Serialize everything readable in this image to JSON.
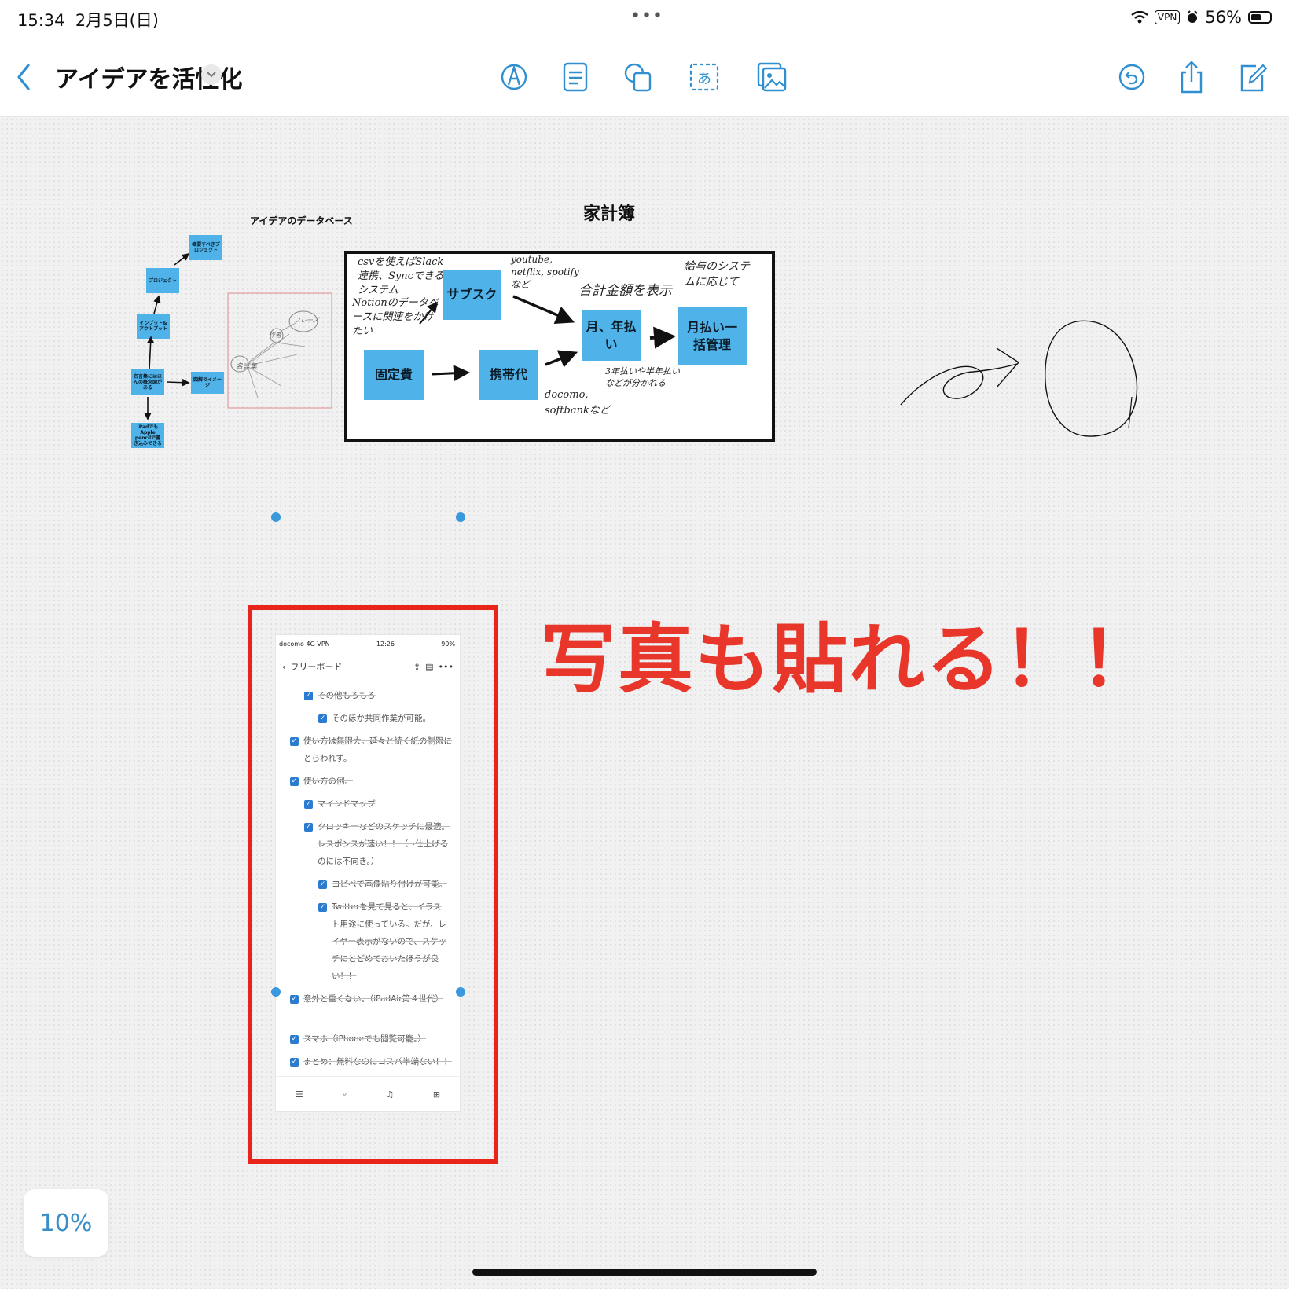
{
  "status_bar": {
    "time": "15:34",
    "date": "2月5日(日)",
    "vpn": "VPN",
    "battery_text": "56%",
    "battery_level": 0.56,
    "dots": "•••"
  },
  "toolbar": {
    "title": "アイデアを活性化"
  },
  "canvas": {
    "mindmap": {
      "title": "アイデアのデータベース",
      "nodes": [
        "概要すべきプロジェクト",
        "プロジェクト",
        "インプット&アウトプット",
        "名言集にはほんの概念図がある",
        "図解でイメージ",
        "iPadでもApple pencilで書き込みできる"
      ],
      "sketch_labels": [
        "名言集",
        "フレーズ",
        "作者"
      ]
    },
    "flow": {
      "title": "家計簿",
      "boxes": [
        "サブスク",
        "固定費",
        "携帯代",
        "月、年払い",
        "月払い一括管理"
      ],
      "notes": [
        "csvを使えばSlack連携、Syncできるシステム",
        "Notionのデータベースに関連をかけたい",
        "youtube, netflix, spotifyなど",
        "合計金額を表示",
        "給与のシステムに応じて",
        "docomo, softbankなど",
        "3年払いや半年払いなどが分かれる"
      ]
    },
    "pasted_screenshot": {
      "status": {
        "carrier": "docomo",
        "network": "4G",
        "vpn": "VPN",
        "time": "12:26",
        "battery": "90%"
      },
      "header_title": "フリーボード",
      "items": [
        {
          "text": "その他もろもろ",
          "level": 1
        },
        {
          "text": "そのほか共同作業が可能。",
          "level": 2
        },
        {
          "text": "使い方は無限大。延々と続く紙の制限にとらわれず。",
          "level": 0
        },
        {
          "text": "使い方の例。",
          "level": 0
        },
        {
          "text": "マインドマップ",
          "level": 1
        },
        {
          "text": "クロッキーなどのスケッチに最適。レスポンスが速い！！（→仕上げるのには不向き。）",
          "level": 1
        },
        {
          "text": "コピペで画像貼り付けが可能。",
          "level": 2
        },
        {
          "text": "Twitterを見て見ると、イラスト用途に使っている。だが、レイヤー表示がないので、スケッチにとどめておいたほうが良い！！",
          "level": 2
        },
        {
          "text": "意外と重くない。（iPadAir第４世代）",
          "level": 0
        },
        {
          "text": "スマホ（iPhoneでも閲覧可能。）",
          "level": 0
        },
        {
          "text": "まとめ：無料なのにコスパ半端ない！！",
          "level": 0
        }
      ]
    },
    "caption": "写真も貼れる！！",
    "zoom": "10%"
  },
  "colors": {
    "accent": "#3a8fc8",
    "box_blue": "#4fb3ea",
    "caption_red": "#e8362a",
    "frame_red": "#e8251a"
  }
}
